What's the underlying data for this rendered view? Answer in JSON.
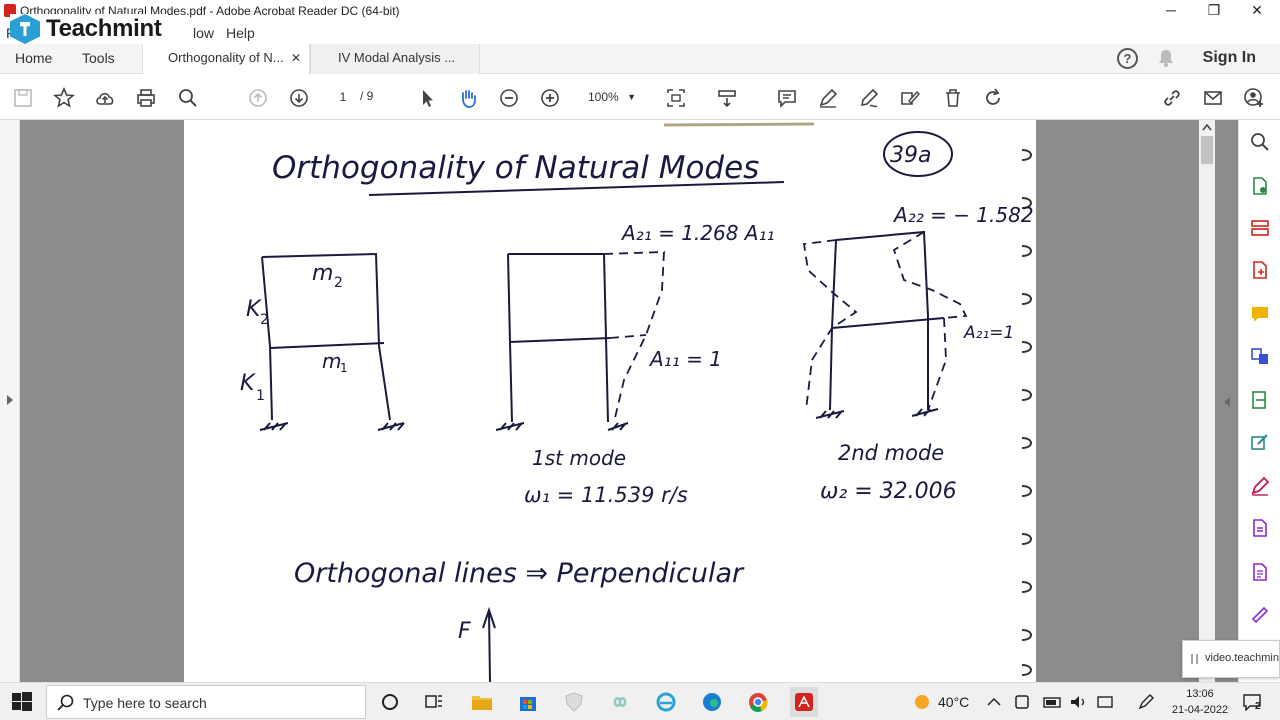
{
  "window": {
    "title": "Orthogonality of Natural Modes.pdf - Adobe Acrobat Reader DC (64-bit)",
    "minimize": "─",
    "restore": "❐",
    "close": "✕"
  },
  "menu": {
    "partial_left": "F",
    "window": "low",
    "help": "Help"
  },
  "overlay_logo": {
    "name": "Teachmint"
  },
  "tabs": {
    "home": "Home",
    "tools": "Tools",
    "doc1": "Orthogonality of N...",
    "doc1_close": "✕",
    "doc2": "IV Modal Analysis ...",
    "sign_in": "Sign In",
    "help": "?"
  },
  "toolbar": {
    "page_current": "1",
    "page_total": "/  9",
    "zoom": "100%",
    "zoom_caret": "▼"
  },
  "document": {
    "title": "Orthogonality of Natural Modes",
    "page_tag": "39a",
    "frame1": {
      "m2": "m",
      "m2_sub": "2",
      "m1": "m",
      "m1_sub": "1",
      "k2": "K",
      "k2_sub": "2",
      "k1": "K",
      "k1_sub": "1"
    },
    "frame2": {
      "a21": "A₂₁ = 1.268 A₁₁",
      "a11": "A₁₁ = 1",
      "mode_label": "1st mode",
      "omega": "ω₁ = 11.539 r/s"
    },
    "frame3": {
      "a22": "A₂₂ = − 1.582",
      "a12": "A₂₁=1",
      "mode_label": "2nd mode",
      "omega": "ω₂ = 32.006"
    },
    "line2": "Orthogonal lines ⇒ Perpendicular",
    "axis_label": "F"
  },
  "video_toast": "video.teachmin",
  "taskbar": {
    "search_placeholder": "Type here to search",
    "weather": "40°C",
    "time": "13:06",
    "date": "21-04-2022",
    "notif_count": "2"
  }
}
